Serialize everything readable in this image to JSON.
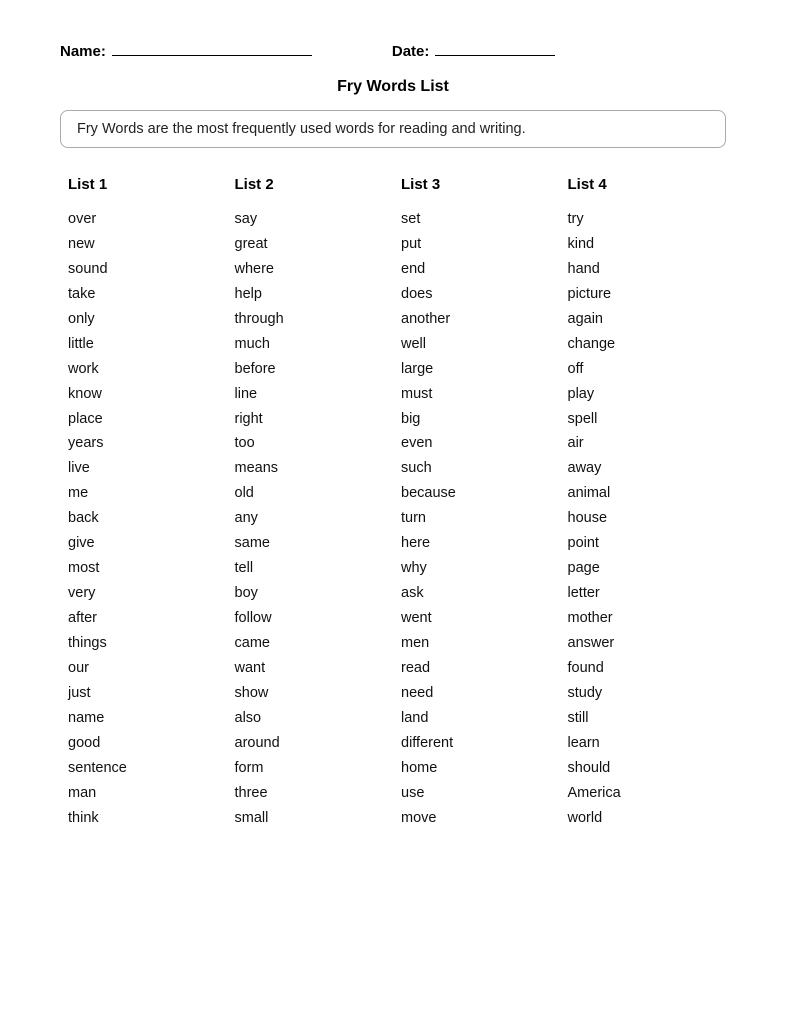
{
  "header": {
    "name_label": "Name:",
    "date_label": "Date:"
  },
  "title": "Fry Words List",
  "description": "Fry Words are the most frequently used words for reading and writing.",
  "lists": [
    {
      "header": "List 1",
      "words": [
        "over",
        "new",
        "sound",
        "take",
        "only",
        "little",
        "work",
        "know",
        "place",
        "years",
        "live",
        "me",
        "back",
        "give",
        "most",
        "very",
        "after",
        "things",
        "our",
        "just",
        "name",
        "good",
        "sentence",
        "man",
        "think"
      ]
    },
    {
      "header": "List 2",
      "words": [
        "say",
        "great",
        "where",
        "help",
        "through",
        "much",
        "before",
        "line",
        "right",
        "too",
        "means",
        "old",
        "any",
        "same",
        "tell",
        "boy",
        "follow",
        "came",
        "want",
        "show",
        "also",
        "around",
        "form",
        "three",
        "small"
      ]
    },
    {
      "header": "List 3",
      "words": [
        "set",
        "put",
        "end",
        "does",
        "another",
        "well",
        "large",
        "must",
        "big",
        "even",
        "such",
        "because",
        "turn",
        "here",
        "why",
        "ask",
        "went",
        "men",
        "read",
        "need",
        "land",
        "different",
        "home",
        "use",
        "move"
      ]
    },
    {
      "header": "List 4",
      "words": [
        "try",
        "kind",
        "hand",
        "picture",
        "again",
        "change",
        "off",
        "play",
        "spell",
        "air",
        "away",
        "animal",
        "house",
        "point",
        "page",
        "letter",
        "mother",
        "answer",
        "found",
        "study",
        "still",
        "learn",
        "should",
        "America",
        "world"
      ]
    }
  ]
}
